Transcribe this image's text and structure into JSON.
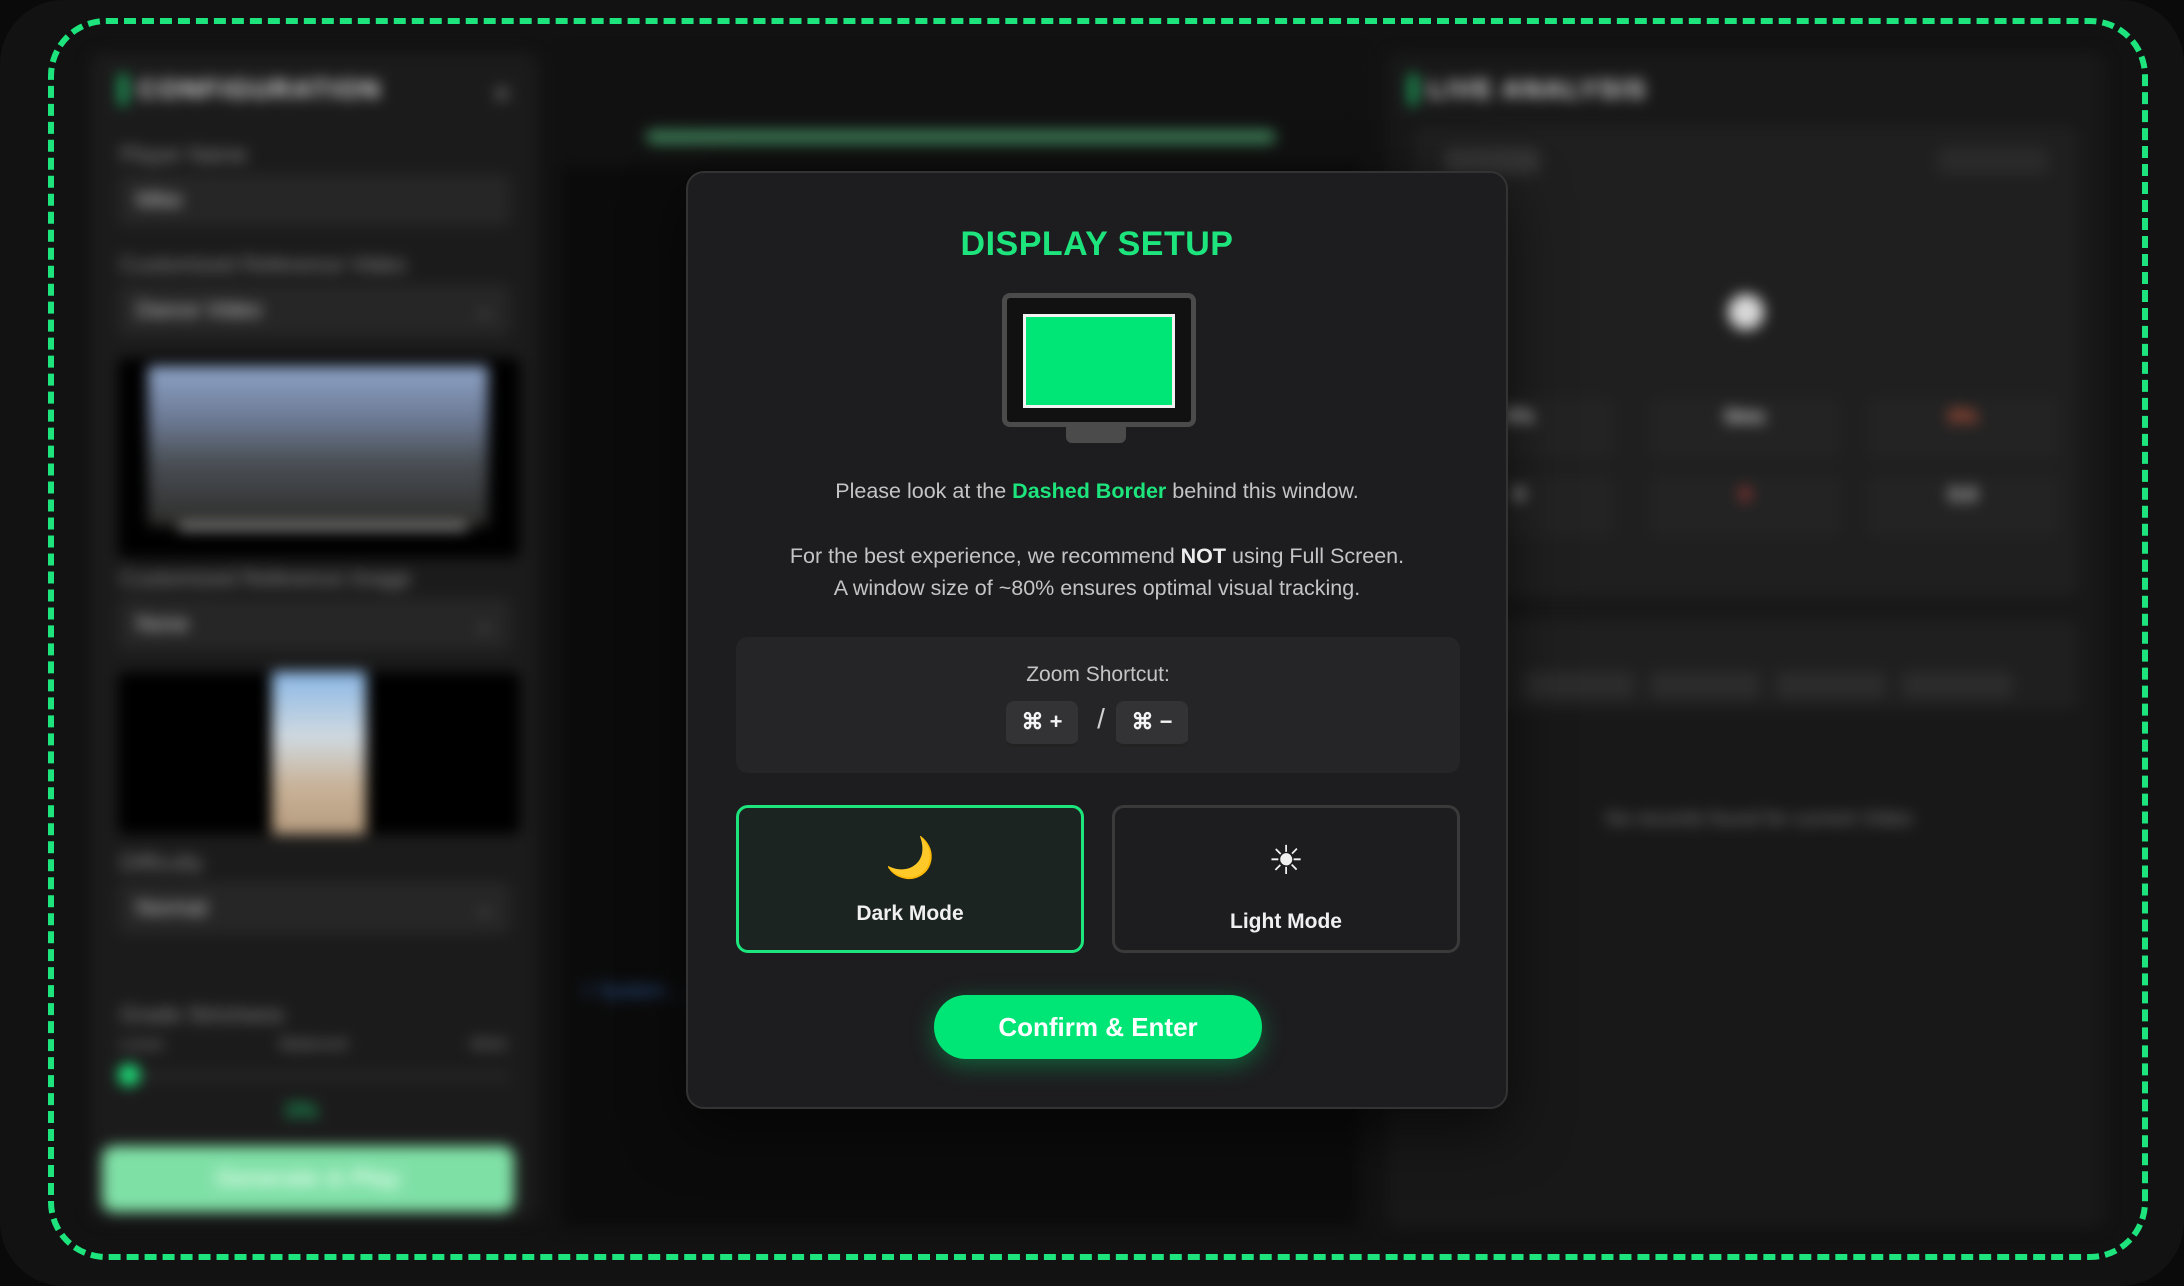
{
  "modal": {
    "title": "DISPLAY SETUP",
    "line1_prefix": "Please look at the ",
    "line1_highlight": "Dashed Border",
    "line1_suffix": " behind this window.",
    "line2_prefix": "For the best experience, we recommend ",
    "line2_bold": "NOT",
    "line2_suffix": " using Full Screen.",
    "line3": "A window size of ~80% ensures optimal visual tracking.",
    "zoom_label": "Zoom Shortcut:",
    "zoom_in_keys": "⌘ +",
    "zoom_separator": "/",
    "zoom_out_keys": "⌘ −",
    "dark_mode_icon": "🌙",
    "dark_mode_label": "Dark Mode",
    "light_mode_icon": "☀",
    "light_mode_label": "Light Mode",
    "confirm_label": "Confirm & Enter",
    "selected_mode": "dark"
  },
  "colors": {
    "accent": "#1de47c",
    "screen_green": "#00e676",
    "modal_bg": "#1d1d1f"
  },
  "background": {
    "left_panel": {
      "title": "CONFIGURATION",
      "close_icon": "×",
      "field1_label": "Player Name",
      "field1_value": "Mike",
      "field2_label": "Customized Reference Video",
      "field2_value": "Dance Video",
      "field3_label": "Customized Reference Image",
      "field3_value": "None",
      "field4_label": "Difficulty",
      "field4_value": "Normal",
      "slider_label": "Grade Strictness",
      "slider_ticks": [
        "Loose",
        "Balanced",
        "Strict"
      ],
      "slider_value_text": "0%",
      "generate_label": "Generate & Play"
    },
    "mid_panel": {
      "system_line": "> System ..."
    },
    "right_panel": {
      "title": "LIVE ANALYSIS",
      "stats_row1": [
        "0%",
        "0ms",
        "0%"
      ],
      "stats_row2": [
        "0",
        "0",
        "0.0"
      ],
      "empty_message": "No records found for current Video"
    }
  }
}
